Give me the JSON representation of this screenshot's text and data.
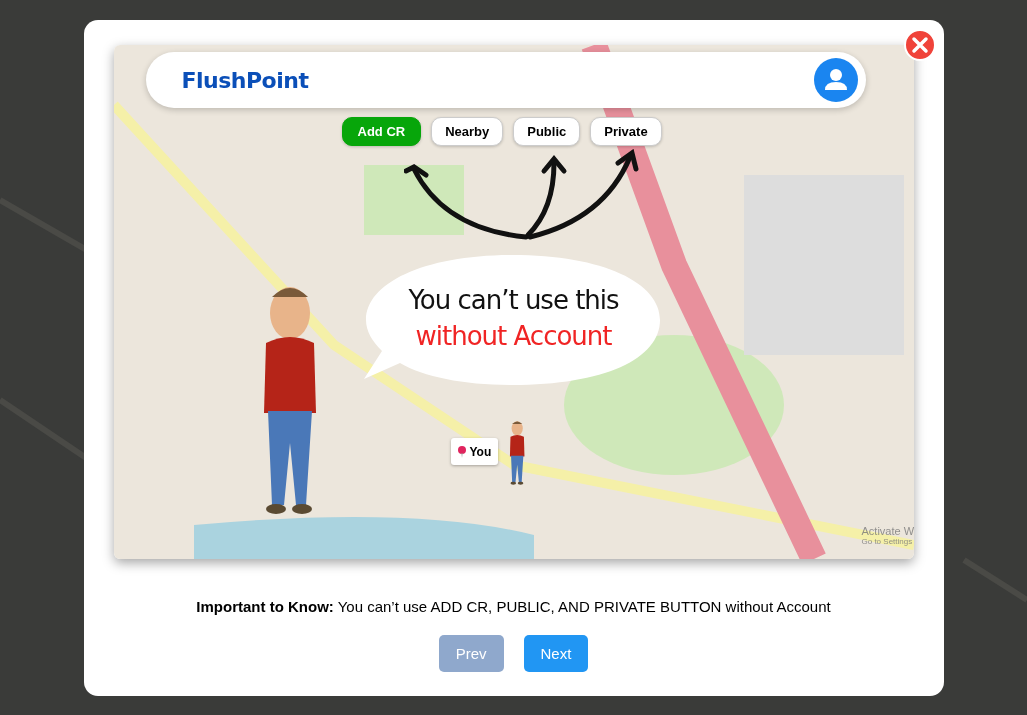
{
  "app_preview": {
    "logo": "FlushPoint",
    "buttons": [
      {
        "label": "Add CR",
        "kind": "primary"
      },
      {
        "label": "Nearby",
        "kind": "outline"
      },
      {
        "label": "Public",
        "kind": "outline"
      },
      {
        "label": "Private",
        "kind": "outline"
      }
    ],
    "speech_bubble": [
      {
        "text": "You can’t use this",
        "emphasis": false
      },
      {
        "text": "without Account",
        "emphasis": true
      }
    ],
    "location_marker": "You",
    "os_notice": [
      "Activate W",
      "Go to Settings"
    ]
  },
  "caption": "**Important to Know:** You can’t use ADD CR, PUBLIC, AND PRIVATE BUTTON without Account",
  "nav_buttons": [
    {
      "label": "Prev",
      "disabled": true
    },
    {
      "label": "Next",
      "disabled": false
    }
  ]
}
